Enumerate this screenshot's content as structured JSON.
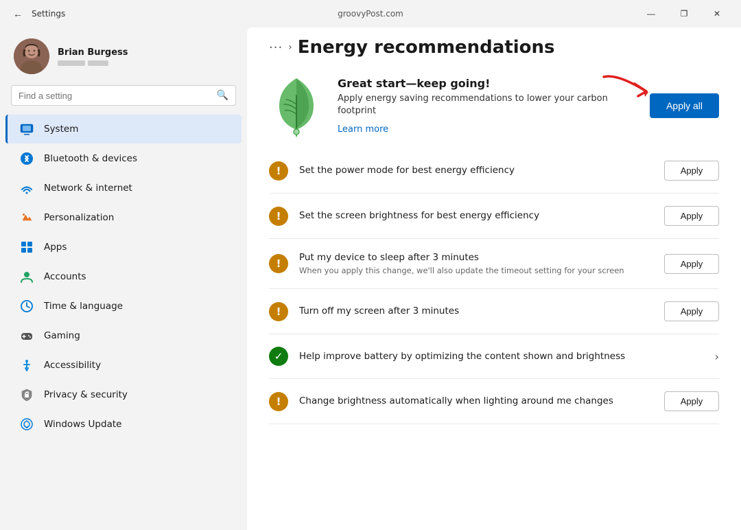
{
  "titlebar": {
    "app_name": "Settings",
    "url": "groovyPost.com",
    "minimize_label": "—",
    "restore_label": "❐",
    "close_label": "✕",
    "back_label": "←"
  },
  "sidebar": {
    "profile": {
      "name": "Brian Burgess"
    },
    "search": {
      "placeholder": "Find a setting"
    },
    "nav_items": [
      {
        "id": "system",
        "label": "System",
        "active": true
      },
      {
        "id": "bluetooth",
        "label": "Bluetooth & devices",
        "active": false
      },
      {
        "id": "network",
        "label": "Network & internet",
        "active": false
      },
      {
        "id": "personalization",
        "label": "Personalization",
        "active": false
      },
      {
        "id": "apps",
        "label": "Apps",
        "active": false
      },
      {
        "id": "accounts",
        "label": "Accounts",
        "active": false
      },
      {
        "id": "time",
        "label": "Time & language",
        "active": false
      },
      {
        "id": "gaming",
        "label": "Gaming",
        "active": false
      },
      {
        "id": "accessibility",
        "label": "Accessibility",
        "active": false
      },
      {
        "id": "privacy",
        "label": "Privacy & security",
        "active": false
      },
      {
        "id": "windows-update",
        "label": "Windows Update",
        "active": false
      }
    ]
  },
  "content": {
    "breadcrumb_dots": "···",
    "breadcrumb_chevron": "›",
    "page_title": "Energy recommendations",
    "hero": {
      "title": "Great start—keep going!",
      "description": "Apply energy saving recommendations to lower your carbon footprint",
      "learn_more": "Learn more",
      "apply_all_label": "Apply all"
    },
    "recommendations": [
      {
        "id": "power-mode",
        "icon_type": "warning",
        "title": "Set the power mode for best energy efficiency",
        "subtitle": "",
        "action": "Apply",
        "has_chevron": false
      },
      {
        "id": "screen-brightness",
        "icon_type": "warning",
        "title": "Set the screen brightness for best energy efficiency",
        "subtitle": "",
        "action": "Apply",
        "has_chevron": false
      },
      {
        "id": "sleep-3min",
        "icon_type": "warning",
        "title": "Put my device to sleep after 3 minutes",
        "subtitle": "When you apply this change, we'll also update the timeout setting for your screen",
        "action": "Apply",
        "has_chevron": false
      },
      {
        "id": "screen-off-3min",
        "icon_type": "warning",
        "title": "Turn off my screen after 3 minutes",
        "subtitle": "",
        "action": "Apply",
        "has_chevron": false
      },
      {
        "id": "battery-optimize",
        "icon_type": "success",
        "title": "Help improve battery by optimizing the content shown and brightness",
        "subtitle": "",
        "action": "",
        "has_chevron": true
      },
      {
        "id": "auto-brightness",
        "icon_type": "warning",
        "title": "Change brightness automatically when lighting around me changes",
        "subtitle": "",
        "action": "Apply",
        "has_chevron": false
      }
    ]
  }
}
